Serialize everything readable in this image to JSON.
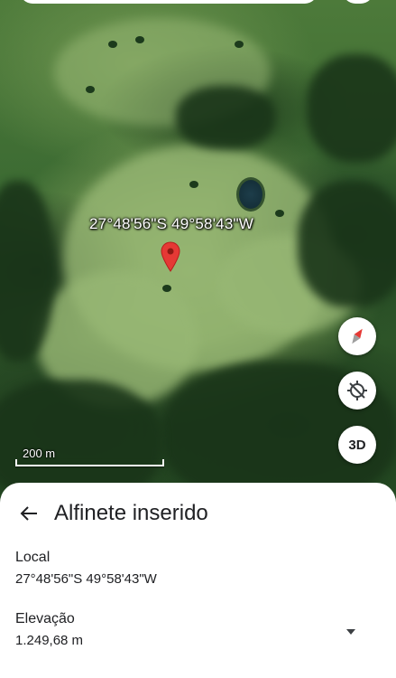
{
  "map": {
    "pin_coordinates_label": "27°48'56\"S 49°58'43\"W",
    "scale_label": "200 m",
    "controls": {
      "compass_icon": "compass-icon",
      "location_icon": "location-crosshair-icon",
      "three_d_label": "3D"
    }
  },
  "sheet": {
    "title": "Alfinete inserido",
    "back_icon": "arrow-left-icon",
    "local": {
      "label": "Local",
      "value": "27°48'56\"S 49°58'43\"W"
    },
    "elevation": {
      "label": "Elevação",
      "value": "1.249,68 m"
    },
    "expand_icon": "caret-down-icon"
  },
  "colors": {
    "pin_red": "#e53935",
    "compass_red": "#e53935",
    "sheet_background": "#ffffff",
    "text_primary": "#202124"
  }
}
